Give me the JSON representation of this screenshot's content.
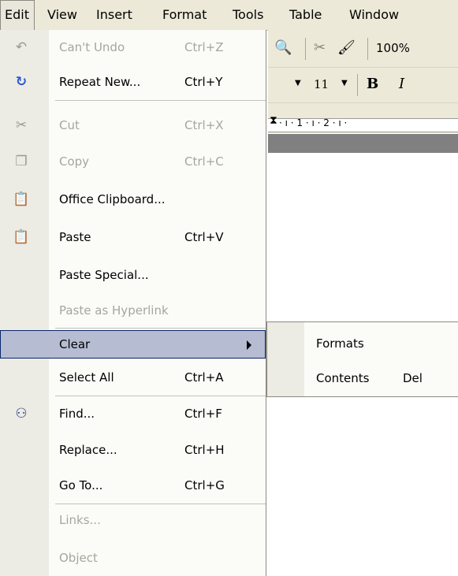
{
  "menubar": {
    "items": [
      {
        "label": "Edit"
      },
      {
        "label": "View"
      },
      {
        "label": "Insert"
      },
      {
        "label": "Format"
      },
      {
        "label": "Tools"
      },
      {
        "label": "Table"
      },
      {
        "label": "Window"
      }
    ]
  },
  "toolbar": {
    "zoom": "100%",
    "font_size": "11",
    "bold": "B",
    "italic": "I",
    "ruler_text": "· ı · 1 · ı · 2 · ı ·"
  },
  "edit_menu": {
    "items": [
      {
        "label": "Can't Undo",
        "shortcut": "Ctrl+Z",
        "icon": "undo-icon",
        "enabled": false
      },
      {
        "label": "Repeat New...",
        "shortcut": "Ctrl+Y",
        "icon": "repeat-icon",
        "enabled": true
      },
      {
        "label": "Cut",
        "shortcut": "Ctrl+X",
        "icon": "scissors-icon",
        "enabled": false
      },
      {
        "label": "Copy",
        "shortcut": "Ctrl+C",
        "icon": "copy-icon",
        "enabled": false
      },
      {
        "label": "Office Clipboard...",
        "shortcut": "",
        "icon": "office-clipboard-icon",
        "enabled": true
      },
      {
        "label": "Paste",
        "shortcut": "Ctrl+V",
        "icon": "paste-icon",
        "enabled": true
      },
      {
        "label": "Paste Special...",
        "shortcut": "",
        "icon": "",
        "enabled": true
      },
      {
        "label": "Paste as Hyperlink",
        "shortcut": "",
        "icon": "",
        "enabled": false
      },
      {
        "label": "Clear",
        "shortcut": "",
        "icon": "",
        "enabled": true,
        "submenu": true,
        "highlighted": true
      },
      {
        "label": "Select All",
        "shortcut": "Ctrl+A",
        "icon": "",
        "enabled": true
      },
      {
        "label": "Find...",
        "shortcut": "Ctrl+F",
        "icon": "binoculars-icon",
        "enabled": true
      },
      {
        "label": "Replace...",
        "shortcut": "Ctrl+H",
        "icon": "",
        "enabled": true
      },
      {
        "label": "Go To...",
        "shortcut": "Ctrl+G",
        "icon": "",
        "enabled": true
      },
      {
        "label": "Links...",
        "shortcut": "",
        "icon": "",
        "enabled": false
      },
      {
        "label": "Object",
        "shortcut": "",
        "icon": "",
        "enabled": false
      }
    ]
  },
  "clear_submenu": {
    "items": [
      {
        "label": "Formats",
        "shortcut": ""
      },
      {
        "label": "Contents",
        "shortcut": "Del"
      }
    ]
  },
  "colors": {
    "highlight_bg": "#b6bdd2",
    "highlight_border": "#0a246a",
    "menu_gutter": "#ecebe4",
    "disabled_text": "#a7a69c"
  }
}
